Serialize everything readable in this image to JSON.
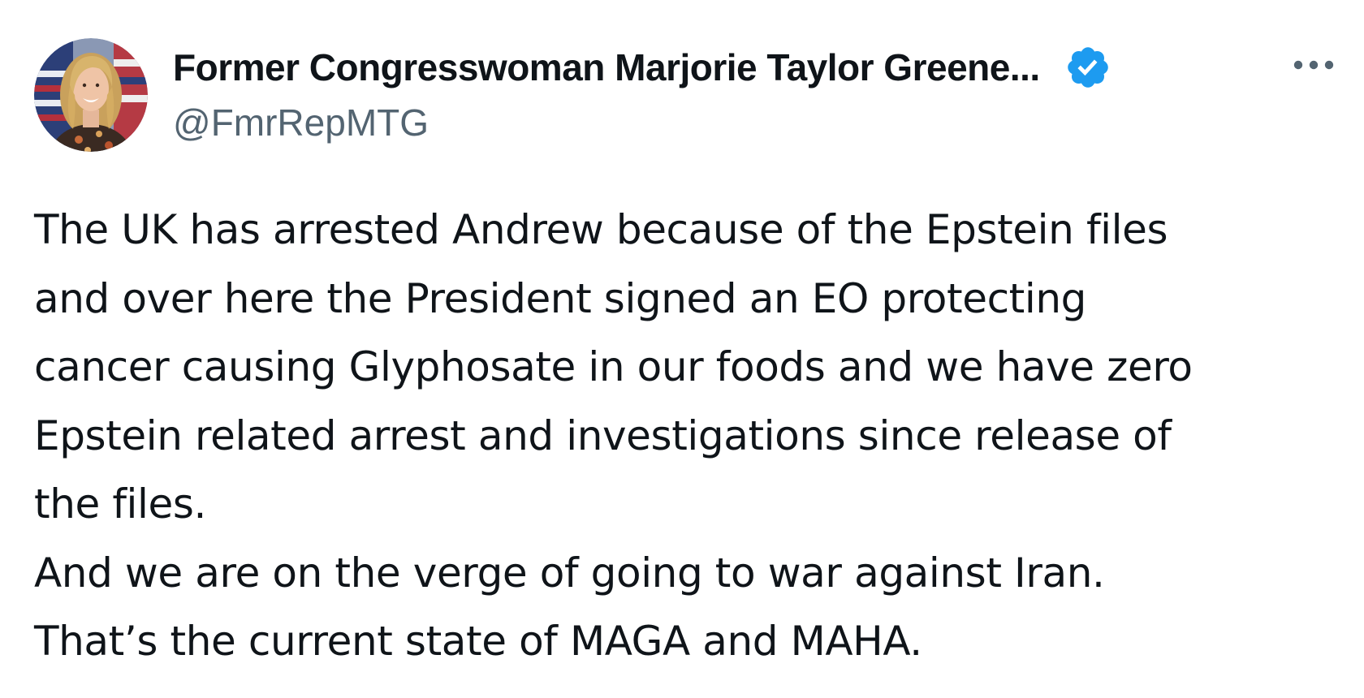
{
  "author": {
    "display_name": "Former Congresswoman Marjorie Taylor Greene...",
    "handle": "@FmrRepMTG",
    "verified": true,
    "avatar_icon": "profile-photo"
  },
  "menu": {
    "icon": "more-horizontal-icon",
    "glyph": "•••"
  },
  "post": {
    "lines": [
      "The UK has arrested Andrew because of the Epstein files",
      "and over here the President signed an EO protecting",
      "cancer causing Glyphosate in our foods and we have zero",
      "Epstein related arrest and investigations since release of",
      "the files.",
      "And we are on the verge of going to war against Iran.",
      "That’s the current state of MAGA and MAHA."
    ]
  },
  "colors": {
    "text": "#0f1419",
    "secondary_text": "#536471",
    "verified_badge": "#1d9bf0",
    "background": "#ffffff"
  }
}
